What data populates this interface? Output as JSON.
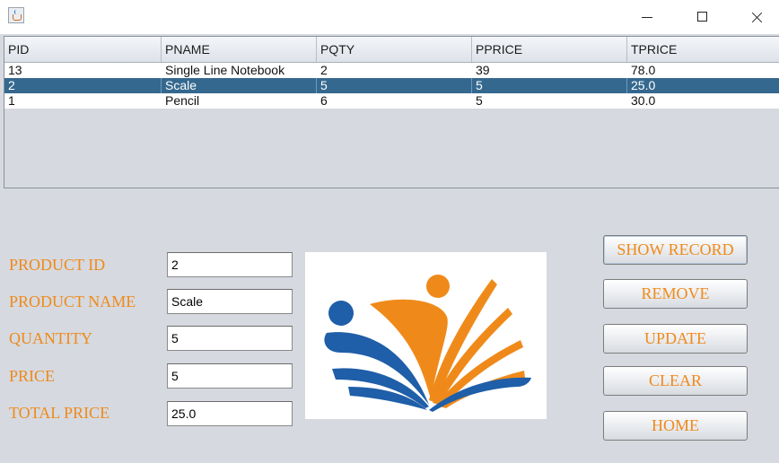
{
  "window": {
    "icon": "java-cup-icon",
    "controls": [
      "minimize-icon",
      "maximize-icon",
      "close-icon"
    ]
  },
  "table": {
    "columns": [
      "PID",
      "PNAME",
      "PQTY",
      "PPRICE",
      "TPRICE"
    ],
    "rows": [
      {
        "pid": "13",
        "pname": "Single Line Notebook",
        "pqty": "2",
        "pprice": "39",
        "tprice": "78.0",
        "selected": false
      },
      {
        "pid": "2",
        "pname": "Scale",
        "pqty": "5",
        "pprice": "5",
        "tprice": "25.0",
        "selected": true
      },
      {
        "pid": "1",
        "pname": "Pencil",
        "pqty": "6",
        "pprice": "5",
        "tprice": "30.0",
        "selected": false
      }
    ]
  },
  "form": {
    "product_id_label": "PRODUCT ID",
    "product_id_value": "2",
    "product_name_label": "PRODUCT NAME",
    "product_name_value": "Scale",
    "quantity_label": "QUANTITY",
    "quantity_value": "5",
    "price_label": "PRICE",
    "price_value": "5",
    "total_price_label": "TOTAL PRICE",
    "total_price_value": "25.0"
  },
  "buttons": {
    "show_record": "SHOW RECORD",
    "remove": "REMOVE",
    "update": "UPDATE",
    "clear": "CLEAR",
    "home": "HOME"
  },
  "colors": {
    "label_orange": "#ef8a1a",
    "selection_blue": "#35688f",
    "logo_blue": "#1f5ea8",
    "logo_orange": "#ef8a1a"
  }
}
